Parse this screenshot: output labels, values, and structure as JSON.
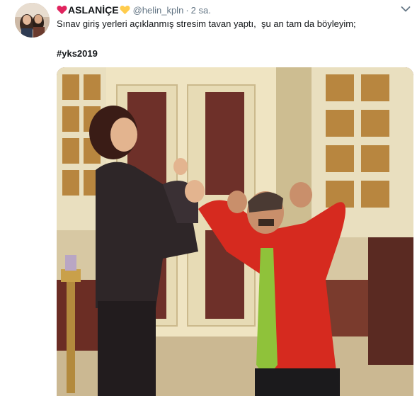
{
  "tweet": {
    "display_name": "ASLANİÇE",
    "handle": "@helin_kpln",
    "separator": "·",
    "time": "2 sa.",
    "text": "Sınav giriş yerleri açıklanmış stresim tavan yaptı,  şu an tam da böyleyim;",
    "hashtag": "#yks2019",
    "icons": {
      "left_emoji": "red-heart-icon",
      "right_emoji": "yellow-heart-icon",
      "menu": "chevron-down-icon"
    }
  },
  "colors": {
    "text": "#14171a",
    "muted": "#657786",
    "red_heart": "#e0245e",
    "yellow_heart": "#ffcc4d"
  }
}
